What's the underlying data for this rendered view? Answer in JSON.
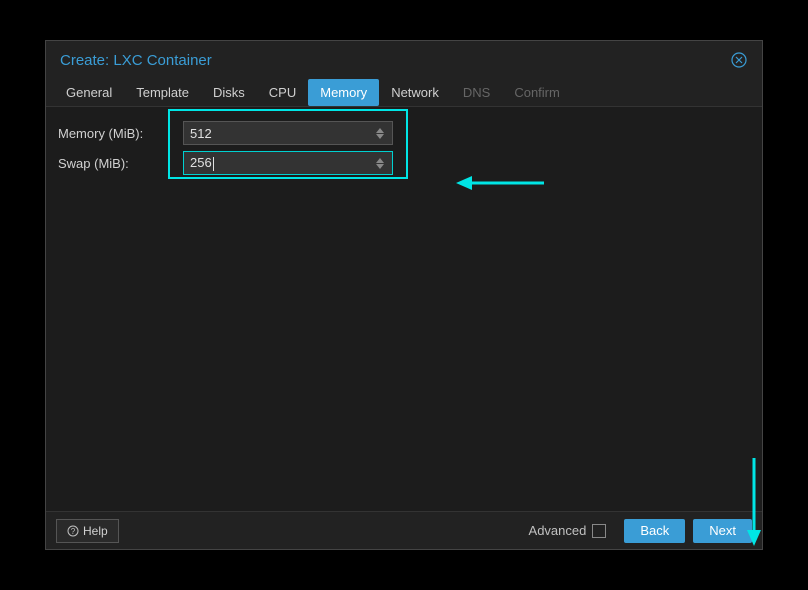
{
  "dialog": {
    "title": "Create: LXC Container"
  },
  "tabs": {
    "general": "General",
    "template": "Template",
    "disks": "Disks",
    "cpu": "CPU",
    "memory": "Memory",
    "network": "Network",
    "dns": "DNS",
    "confirm": "Confirm"
  },
  "form": {
    "memory_label": "Memory (MiB):",
    "memory_value": "512",
    "swap_label": "Swap (MiB):",
    "swap_value": "256"
  },
  "footer": {
    "help": "Help",
    "advanced": "Advanced",
    "back": "Back",
    "next": "Next"
  },
  "colors": {
    "accent": "#3a9dd6",
    "highlight": "#00e5e5"
  }
}
